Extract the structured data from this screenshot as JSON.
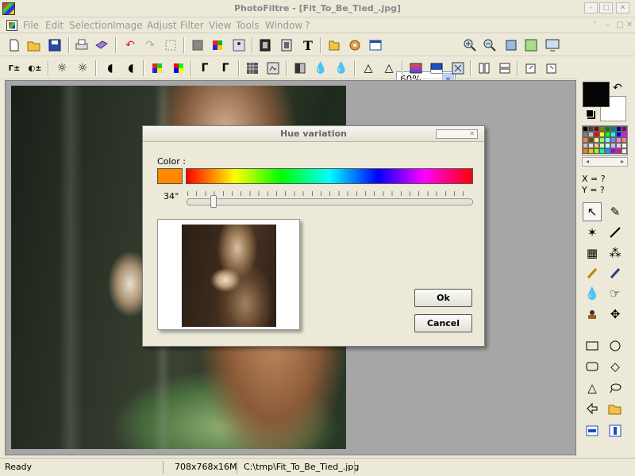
{
  "window": {
    "title": "PhotoFiltre - [Fit_To_Be_Tied_.jpg]",
    "controls": [
      "–",
      "□",
      "✕"
    ],
    "mdi_controls": [
      "˅",
      "–",
      "□",
      "✕"
    ]
  },
  "menu": {
    "items": [
      "File",
      "Edit",
      "Selection",
      "Image",
      "Adjust",
      "Filter",
      "View",
      "Tools",
      "Window",
      "?"
    ]
  },
  "toolbar": {
    "zoom_value": "60%"
  },
  "right_panel": {
    "foreground_color": "#050505",
    "background_color": "#ffffff",
    "palette": [
      "#000000",
      "#404040",
      "#800000",
      "#808000",
      "#008000",
      "#008080",
      "#000080",
      "#800080",
      "#808080",
      "#c0c0c0",
      "#ff0000",
      "#ffff00",
      "#00ff00",
      "#00ffff",
      "#0000ff",
      "#ff00ff",
      "#ff8040",
      "#804000",
      "#ffff80",
      "#80ff80",
      "#80ffff",
      "#8080ff",
      "#ff80c0",
      "#ff8080",
      "#c0c0c0",
      "#e0e0e0",
      "#ffc080",
      "#c0ffc0",
      "#c0ffff",
      "#c0c0ff",
      "#ffc0ff",
      "#ffffff",
      "#ff8000",
      "#ffc000",
      "#a0ff00",
      "#00ffa0",
      "#00a0ff",
      "#a000ff",
      "#ff00a0",
      "#f0f0f0"
    ],
    "coord_x": "X = ?",
    "coord_y": "Y = ?"
  },
  "status": {
    "state": "Ready",
    "image_info": "708x768x16M",
    "path": "C:\\tmp\\Fit_To_Be_Tied_.jpg"
  },
  "dialog": {
    "title": "Hue variation",
    "color_label": "Color :",
    "swatch_color": "#ff8800",
    "angle_value": "34°",
    "slider_value_deg": 34,
    "slider_range_deg": [
      0,
      360
    ],
    "ok_label": "Ok",
    "cancel_label": "Cancel"
  }
}
